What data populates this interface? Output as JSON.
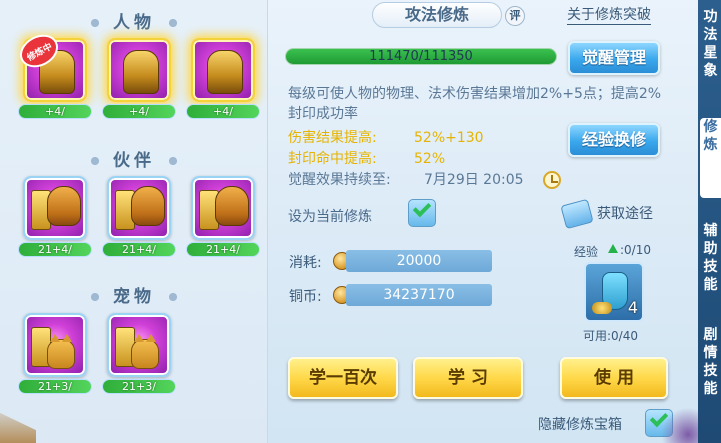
{
  "left": {
    "sections": {
      "characters": "人物",
      "partners": "伙伴",
      "pets": "宠物"
    },
    "training_badge": "修炼中",
    "characters": [
      {
        "level": "+4/"
      },
      {
        "level": "+4/"
      },
      {
        "level": "+4/"
      }
    ],
    "partners": [
      {
        "level": "21+4/"
      },
      {
        "level": "21+4/"
      },
      {
        "level": "21+4/"
      }
    ],
    "pets": [
      {
        "level": "21+3/"
      },
      {
        "level": "21+3/"
      }
    ]
  },
  "header": {
    "title": "攻法修炼",
    "rate": "评",
    "breakthrough_link": "关于修炼突破"
  },
  "progress": {
    "text": "111470/111350",
    "current": 111470,
    "max": 111350
  },
  "buttons": {
    "awaken_manage": "觉醒管理",
    "exp_exchange": "经验换修",
    "learn_100": "学一百次",
    "learn": "学 习",
    "use": "使 用"
  },
  "description": "每级可使人物的物理、法术伤害结果增加2%+5点；提高2%封印成功率",
  "stats": {
    "damage_label": "伤害结果提高:",
    "damage_value": "52%+130",
    "seal_label": "封印命中提高:",
    "seal_value": "52%",
    "duration_label": "觉醒效果持续至:",
    "duration_value": "7月29日 20:05"
  },
  "set_current": {
    "label": "设为当前修炼",
    "checked": true
  },
  "get_way": "获取途径",
  "cost": {
    "label": "消耗:",
    "value": "20000"
  },
  "copper": {
    "label": "铜币:",
    "value": "34237170"
  },
  "treasure": {
    "exp_label": "经验",
    "exp_count": ":0/10",
    "count": "4",
    "usable": "可用:0/40"
  },
  "hide_treasure": {
    "label": "隐藏修炼宝箱",
    "checked": true
  },
  "side_tabs": [
    {
      "text": "功法星象",
      "active": false
    },
    {
      "text": "修炼",
      "active": true
    },
    {
      "text": "辅助技能",
      "active": false
    },
    {
      "text": "剧情技能",
      "active": false
    }
  ],
  "colors": {
    "accent_yellow": "#e6b400",
    "button_blue": "#3aa7ec",
    "button_yellow": "#ffd84a",
    "bar_green": "#2fae3a"
  }
}
